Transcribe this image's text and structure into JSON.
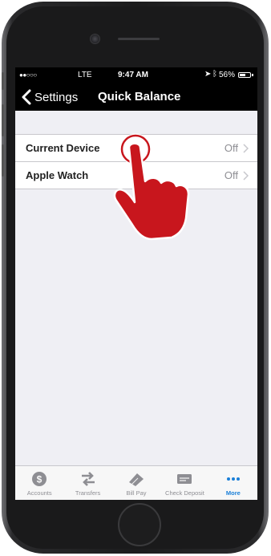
{
  "status_bar": {
    "signal": "●●○○○",
    "carrier": "LTE",
    "time": "9:47 AM",
    "battery_percent": "56%",
    "battery_level": 0.56
  },
  "nav": {
    "back_label": "Settings",
    "title": "Quick Balance"
  },
  "settings": [
    {
      "label": "Current Device",
      "value": "Off"
    },
    {
      "label": "Apple Watch",
      "value": "Off"
    }
  ],
  "tab_bar": [
    {
      "label": "Accounts",
      "icon": "dollar-circle-icon"
    },
    {
      "label": "Transfers",
      "icon": "transfer-arrows-icon"
    },
    {
      "label": "Bill Pay",
      "icon": "bill-pay-icon"
    },
    {
      "label": "Check Deposit",
      "icon": "check-deposit-icon"
    },
    {
      "label": "More",
      "icon": "more-dots-icon",
      "active": true
    }
  ],
  "colors": {
    "nav_background": "#000000",
    "screen_background": "#efeff4",
    "tab_active": "#1a7fd8",
    "tab_inactive": "#8e8e93",
    "hand_pointer": "#c8161d"
  }
}
